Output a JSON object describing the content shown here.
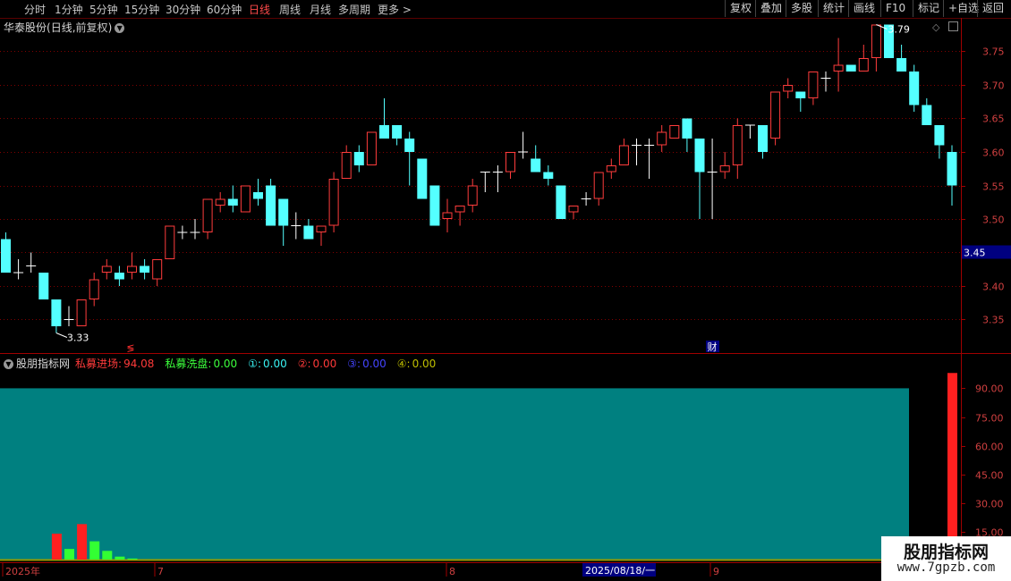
{
  "toolbar": {
    "periods": [
      {
        "label": "分时",
        "active": false
      },
      {
        "label": "1分钟",
        "active": false
      },
      {
        "label": "5分钟",
        "active": false
      },
      {
        "label": "15分钟",
        "active": false
      },
      {
        "label": "30分钟",
        "active": false
      },
      {
        "label": "60分钟",
        "active": false
      },
      {
        "label": "日线",
        "active": true
      },
      {
        "label": "周线",
        "active": false
      },
      {
        "label": "月线",
        "active": false
      },
      {
        "label": "多周期",
        "active": false
      },
      {
        "label": "更多 >",
        "active": false
      }
    ],
    "right_buttons": [
      "复权",
      "叠加",
      "多股",
      "统计",
      "画线",
      "F10",
      "标记",
      "+自选",
      "返回"
    ]
  },
  "stock": {
    "name": "华泰股份",
    "period": "日线",
    "adjust": "前复权"
  },
  "price_axis": {
    "ticks": [
      "3.75",
      "3.70",
      "3.65",
      "3.60",
      "3.55",
      "3.50",
      "3.45",
      "3.40",
      "3.35"
    ],
    "current": "3.45"
  },
  "markers": {
    "high": "3.79",
    "low": "3.33",
    "event_left": "≶",
    "event_right": "财"
  },
  "indicator": {
    "name": "股朋指标网",
    "entries": [
      {
        "label": "私募进场:",
        "value": "94.08",
        "color": "#ff3a3a"
      },
      {
        "label": "私募洗盘:",
        "value": "0.00",
        "color": "#3cff3c"
      },
      {
        "label": "①:",
        "value": "0.00",
        "color": "#39f3f3"
      },
      {
        "label": "②:",
        "value": "0.00",
        "color": "#ff3a3a"
      },
      {
        "label": "③:",
        "value": "0.00",
        "color": "#4444ff"
      },
      {
        "label": "④:",
        "value": "0.00",
        "color": "#bfbf00"
      }
    ],
    "axis_ticks": [
      "90.00",
      "75.00",
      "60.00",
      "45.00",
      "30.00",
      "15.00"
    ]
  },
  "date_axis": {
    "labels": [
      "2025年",
      "7",
      "8",
      "9"
    ],
    "cursor": "2025/08/18/一"
  },
  "watermark": {
    "title": "股朋指标网",
    "url": "www.7gpzb.com"
  },
  "colors": {
    "up": "#ff3c3c",
    "down": "#54ffff",
    "doji": "#ffffff",
    "grid": "#800000",
    "panel": "#008080",
    "baseline": "#999900"
  },
  "chart_data": [
    {
      "type": "candlestick",
      "title": "华泰股份(日线,前复权)",
      "ylim": [
        3.3,
        3.8
      ],
      "candles": [
        [
          3.47,
          3.48,
          3.42,
          3.42
        ],
        [
          3.42,
          3.44,
          3.41,
          3.42
        ],
        [
          3.43,
          3.45,
          3.42,
          3.43
        ],
        [
          3.42,
          3.42,
          3.38,
          3.38
        ],
        [
          3.38,
          3.38,
          3.33,
          3.34
        ],
        [
          3.35,
          3.37,
          3.34,
          3.35
        ],
        [
          3.34,
          3.38,
          3.34,
          3.38
        ],
        [
          3.38,
          3.42,
          3.37,
          3.41
        ],
        [
          3.42,
          3.44,
          3.41,
          3.43
        ],
        [
          3.42,
          3.43,
          3.4,
          3.41
        ],
        [
          3.42,
          3.45,
          3.41,
          3.43
        ],
        [
          3.43,
          3.44,
          3.41,
          3.42
        ],
        [
          3.41,
          3.44,
          3.4,
          3.44
        ],
        [
          3.44,
          3.49,
          3.44,
          3.49
        ],
        [
          3.48,
          3.49,
          3.47,
          3.48
        ],
        [
          3.48,
          3.5,
          3.47,
          3.48
        ],
        [
          3.48,
          3.53,
          3.47,
          3.53
        ],
        [
          3.52,
          3.54,
          3.51,
          3.53
        ],
        [
          3.53,
          3.55,
          3.51,
          3.52
        ],
        [
          3.51,
          3.55,
          3.51,
          3.55
        ],
        [
          3.54,
          3.56,
          3.52,
          3.53
        ],
        [
          3.55,
          3.56,
          3.49,
          3.49
        ],
        [
          3.53,
          3.53,
          3.46,
          3.49
        ],
        [
          3.49,
          3.51,
          3.47,
          3.49
        ],
        [
          3.49,
          3.5,
          3.47,
          3.47
        ],
        [
          3.48,
          3.49,
          3.46,
          3.49
        ],
        [
          3.49,
          3.57,
          3.48,
          3.56
        ],
        [
          3.56,
          3.61,
          3.56,
          3.6
        ],
        [
          3.6,
          3.61,
          3.57,
          3.58
        ],
        [
          3.58,
          3.63,
          3.58,
          3.63
        ],
        [
          3.64,
          3.68,
          3.62,
          3.62
        ],
        [
          3.64,
          3.64,
          3.61,
          3.62
        ],
        [
          3.62,
          3.63,
          3.55,
          3.6
        ],
        [
          3.59,
          3.59,
          3.53,
          3.53
        ],
        [
          3.55,
          3.55,
          3.49,
          3.49
        ],
        [
          3.5,
          3.53,
          3.48,
          3.51
        ],
        [
          3.51,
          3.52,
          3.49,
          3.52
        ],
        [
          3.52,
          3.56,
          3.51,
          3.55
        ],
        [
          3.57,
          3.57,
          3.54,
          3.57
        ],
        [
          3.57,
          3.58,
          3.54,
          3.57
        ],
        [
          3.57,
          3.6,
          3.56,
          3.6
        ],
        [
          3.6,
          3.63,
          3.59,
          3.6
        ],
        [
          3.59,
          3.61,
          3.57,
          3.57
        ],
        [
          3.57,
          3.58,
          3.55,
          3.56
        ],
        [
          3.55,
          3.55,
          3.5,
          3.5
        ],
        [
          3.51,
          3.52,
          3.5,
          3.52
        ],
        [
          3.53,
          3.54,
          3.52,
          3.53
        ],
        [
          3.53,
          3.57,
          3.52,
          3.57
        ],
        [
          3.57,
          3.59,
          3.56,
          3.58
        ],
        [
          3.58,
          3.62,
          3.58,
          3.61
        ],
        [
          3.61,
          3.62,
          3.58,
          3.61
        ],
        [
          3.61,
          3.62,
          3.56,
          3.61
        ],
        [
          3.61,
          3.64,
          3.6,
          3.63
        ],
        [
          3.62,
          3.64,
          3.62,
          3.64
        ],
        [
          3.65,
          3.65,
          3.6,
          3.62
        ],
        [
          3.62,
          3.62,
          3.5,
          3.57
        ],
        [
          3.57,
          3.62,
          3.5,
          3.57
        ],
        [
          3.57,
          3.6,
          3.56,
          3.58
        ],
        [
          3.58,
          3.65,
          3.56,
          3.64
        ],
        [
          3.64,
          3.64,
          3.62,
          3.64
        ],
        [
          3.64,
          3.64,
          3.59,
          3.6
        ],
        [
          3.62,
          3.69,
          3.61,
          3.69
        ],
        [
          3.69,
          3.71,
          3.68,
          3.7
        ],
        [
          3.69,
          3.69,
          3.66,
          3.68
        ],
        [
          3.68,
          3.72,
          3.67,
          3.72
        ],
        [
          3.71,
          3.72,
          3.69,
          3.71
        ],
        [
          3.72,
          3.77,
          3.69,
          3.73
        ],
        [
          3.73,
          3.73,
          3.72,
          3.72
        ],
        [
          3.72,
          3.76,
          3.72,
          3.74
        ],
        [
          3.74,
          3.79,
          3.72,
          3.79
        ],
        [
          3.79,
          3.79,
          3.74,
          3.74
        ],
        [
          3.74,
          3.76,
          3.73,
          3.72
        ],
        [
          3.72,
          3.73,
          3.66,
          3.67
        ],
        [
          3.67,
          3.68,
          3.64,
          3.64
        ],
        [
          3.64,
          3.64,
          3.59,
          3.61
        ],
        [
          3.6,
          3.61,
          3.52,
          3.55
        ]
      ]
    },
    {
      "type": "bar",
      "title": "股朋指标网",
      "ylim": [
        0,
        100
      ],
      "background_value": 90,
      "series": [
        {
          "name": "私募进场",
          "color": "#ff2020",
          "bars": [
            [
              4,
              14
            ],
            [
              6,
              19
            ],
            [
              75,
              98
            ]
          ]
        },
        {
          "name": "私募洗盘",
          "color": "#33ff33",
          "bars": [
            [
              5,
              6
            ],
            [
              7,
              10
            ],
            [
              8,
              5
            ],
            [
              9,
              2
            ],
            [
              10,
              1
            ]
          ]
        }
      ]
    }
  ]
}
